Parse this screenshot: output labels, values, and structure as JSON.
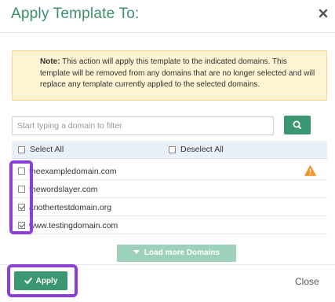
{
  "dialog": {
    "title": "Apply Template To:",
    "close_icon": "close-icon"
  },
  "note": {
    "label": "Note:",
    "text": " This action will apply this template to the indicated domains. This template will be removed from any domains that are no longer selected and will replace any template currently applied to the selected domains."
  },
  "filter": {
    "placeholder": "Start typing a domain to filter",
    "value": "",
    "search_icon": "search-icon"
  },
  "selection": {
    "select_all": "Select All",
    "deselect_all": "Deselect All"
  },
  "domains": [
    {
      "name": "theexampledomain.com",
      "checked": false,
      "warning": true
    },
    {
      "name": "thewordslayer.com",
      "checked": false,
      "warning": false
    },
    {
      "name": "anothertestdomain.org",
      "checked": true,
      "warning": false
    },
    {
      "name": "www.testingdomain.com",
      "checked": true,
      "warning": false
    }
  ],
  "load_more": {
    "label": "Load more Domains"
  },
  "footer": {
    "apply_label": "Apply",
    "close_label": "Close"
  },
  "colors": {
    "accent": "#3b9672",
    "title": "#3c8f6b",
    "highlight": "#8a3fd6",
    "warning": "#f0932b",
    "note_bg": "#fcf3d2"
  }
}
